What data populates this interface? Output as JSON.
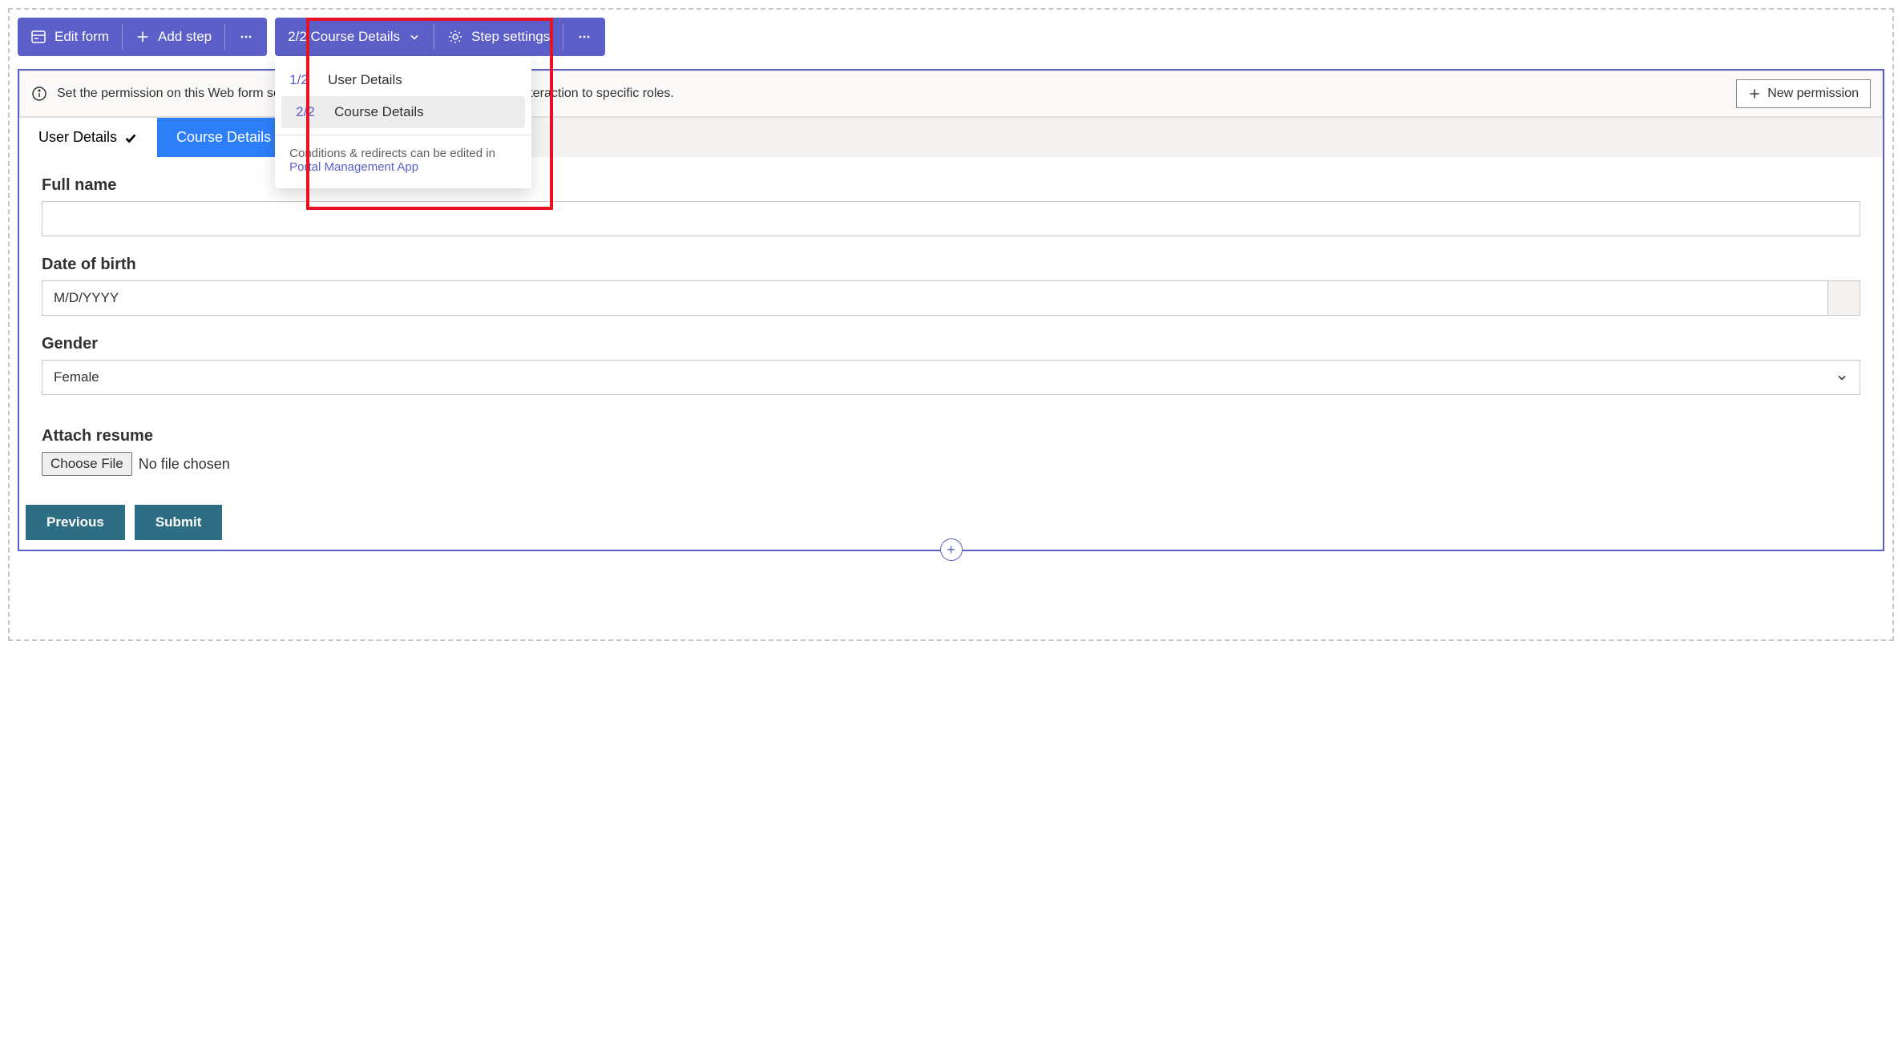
{
  "toolbar": {
    "edit_form": "Edit form",
    "add_step": "Add step",
    "current_step": "2/2 Course Details",
    "step_settings": "Step settings"
  },
  "dropdown": {
    "items": [
      {
        "num": "1/2",
        "label": "User Details"
      },
      {
        "num": "2/2",
        "label": "Course Details"
      }
    ],
    "footer_text": "Conditions & redirects can be edited in",
    "footer_link": "Portal Management App"
  },
  "notice": {
    "text": "Set the permission on this Web form so it can be accessed by anyone or limit the interaction to specific roles.",
    "button": "New permission"
  },
  "tabs": {
    "user_details": "User Details",
    "course_details": "Course Details"
  },
  "form": {
    "full_name_label": "Full name",
    "dob_label": "Date of birth",
    "dob_placeholder": "M/D/YYYY",
    "gender_label": "Gender",
    "gender_value": "Female",
    "attach_label": "Attach resume",
    "choose_file": "Choose File",
    "no_file": "No file chosen",
    "previous": "Previous",
    "submit": "Submit"
  }
}
